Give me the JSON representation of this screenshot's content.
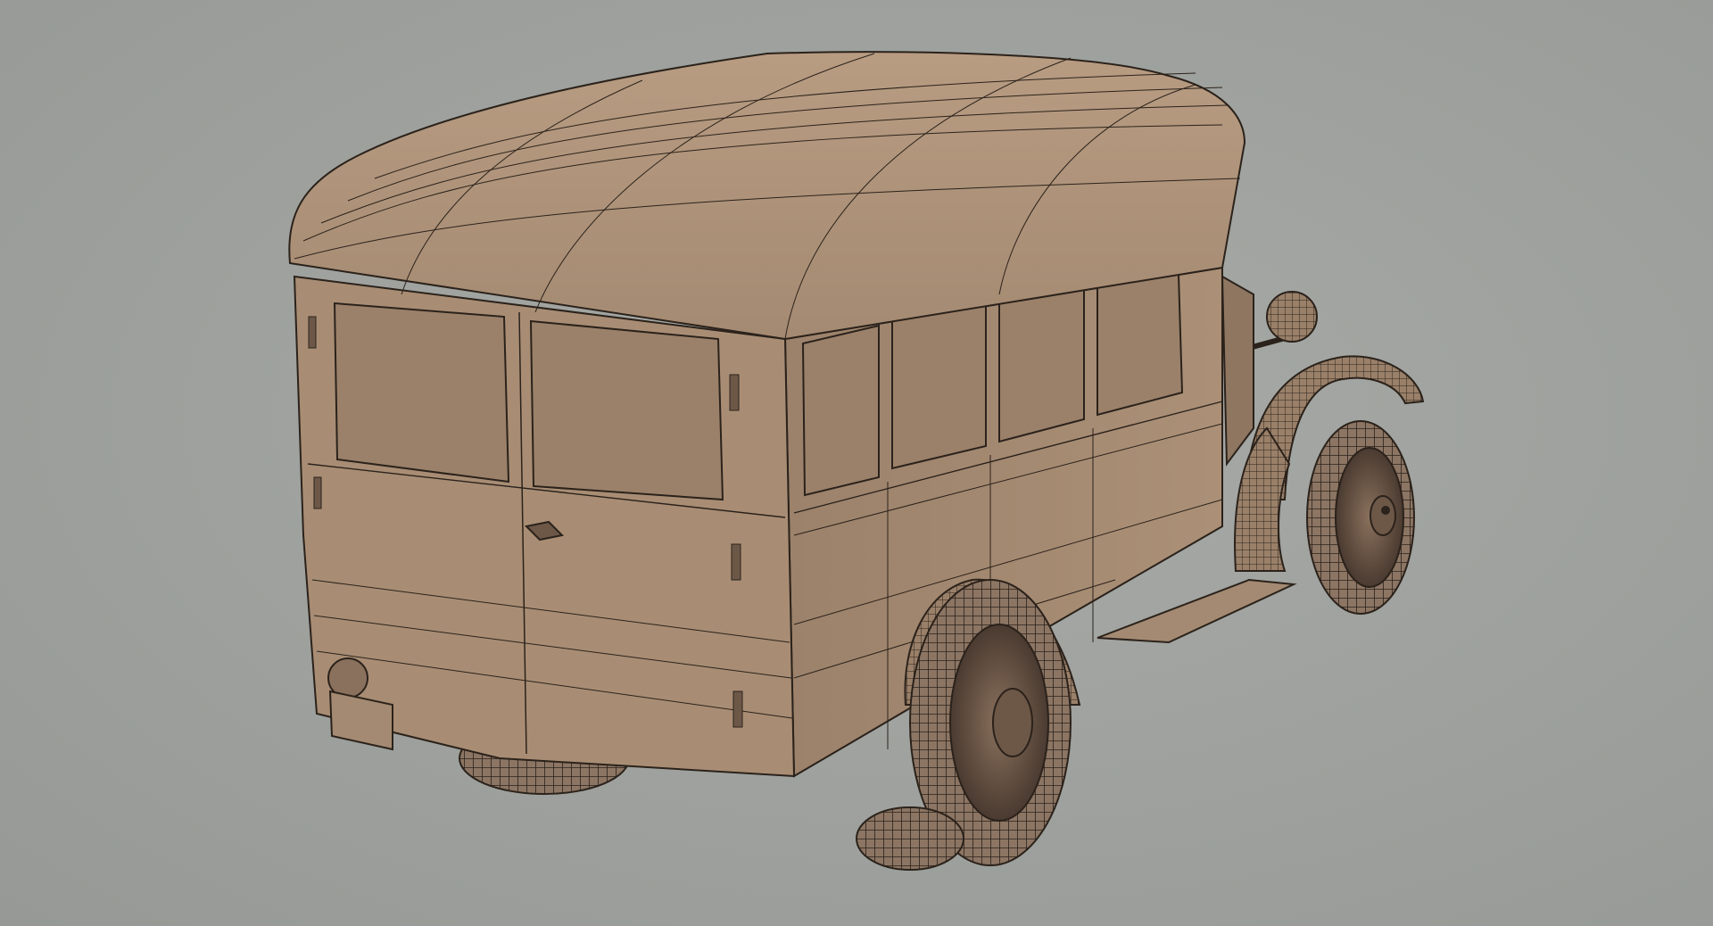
{
  "scene": {
    "subject": "wireframe-van-model",
    "colors": {
      "background": "#9fa29e",
      "body": "#a48a72",
      "body_shadow": "#7d6653",
      "body_light": "#b89c82",
      "wire": "#2b221b",
      "tire": "#3d3029",
      "tire_light": "#8c7563"
    }
  }
}
